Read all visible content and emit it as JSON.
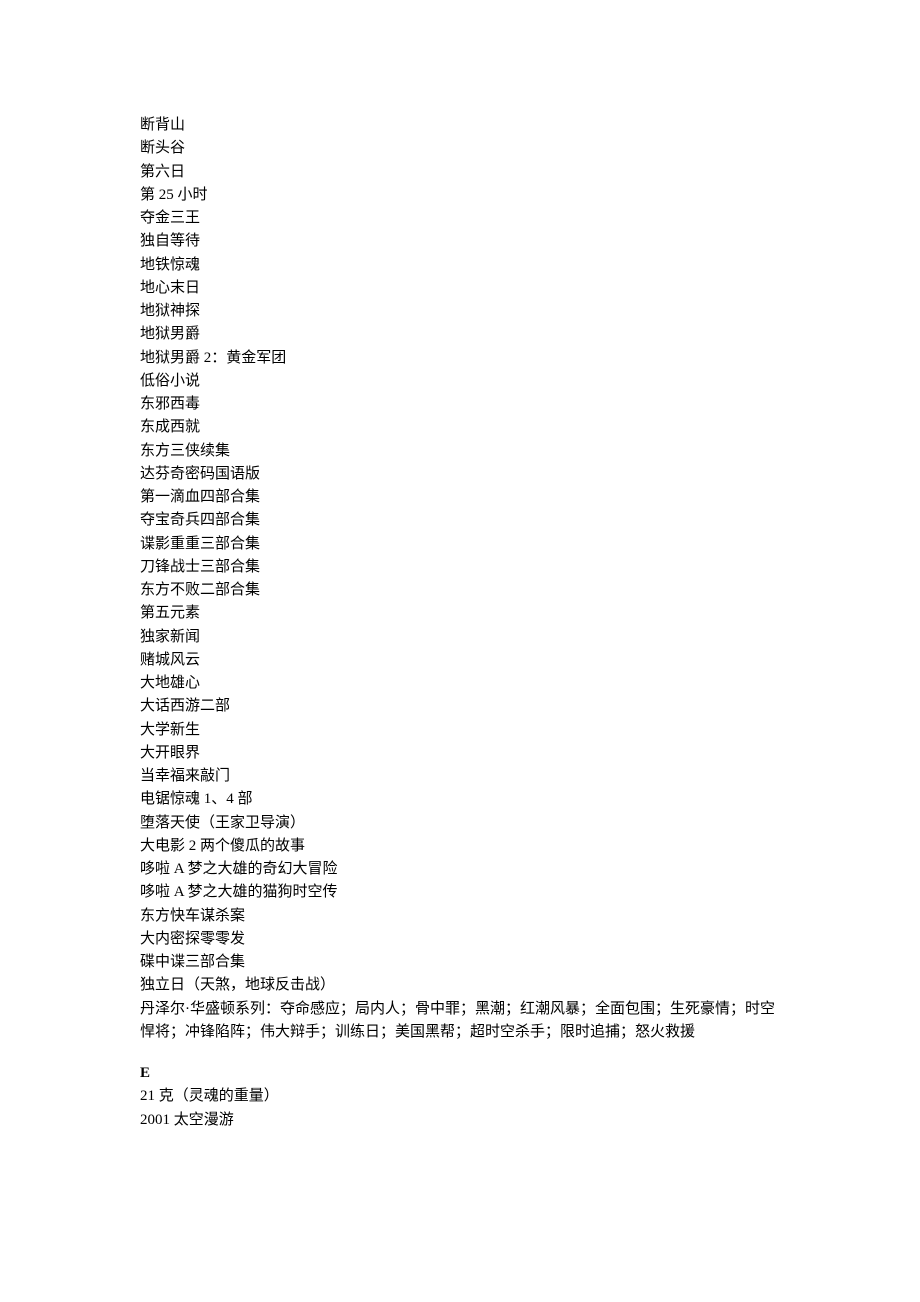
{
  "d_items": [
    "断背山",
    "断头谷",
    "第六日",
    "第 25 小时",
    "夺金三王",
    "独自等待",
    "地铁惊魂",
    "地心末日",
    "地狱神探",
    "地狱男爵",
    "地狱男爵 2：黄金军团",
    "低俗小说",
    "东邪西毒",
    "东成西就",
    "东方三侠续集",
    "达芬奇密码国语版",
    "第一滴血四部合集",
    "夺宝奇兵四部合集",
    "谍影重重三部合集",
    "刀锋战士三部合集",
    "东方不败二部合集",
    "第五元素",
    "独家新闻",
    "赌城风云",
    "大地雄心",
    "大话西游二部",
    "大学新生",
    "大开眼界",
    "当幸福来敲门",
    "电锯惊魂 1、4 部",
    "堕落天使（王家卫导演）",
    "大电影 2 两个傻瓜的故事",
    "哆啦 A 梦之大雄的奇幻大冒险",
    "哆啦 A 梦之大雄的猫狗时空传",
    "东方快车谋杀案",
    "大内密探零零发",
    "碟中谍三部合集",
    "独立日（天煞，地球反击战）",
    "丹泽尔·华盛顿系列：夺命感应；局内人；骨中罪；黑潮；红潮风暴；全面包围；生死豪情；时空悍将；冲锋陷阵；伟大辩手；训练日；美国黑帮；超时空杀手；限时追捕；怒火救援"
  ],
  "e_heading": "E",
  "e_items": [
    "21 克（灵魂的重量）",
    "2001 太空漫游"
  ]
}
